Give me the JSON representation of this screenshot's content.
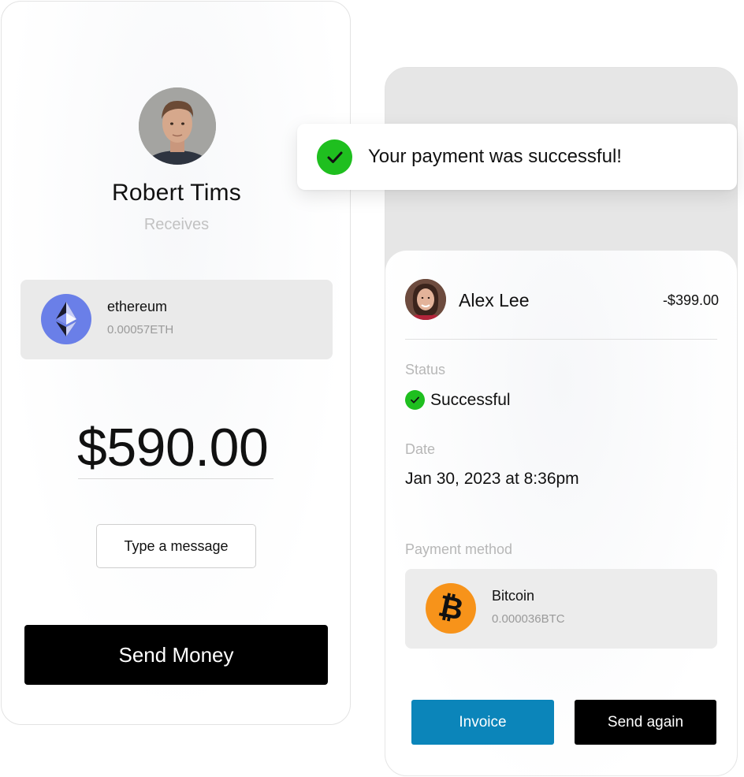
{
  "send_card": {
    "recipient": {
      "name": "Robert Tims",
      "role": "Receives"
    },
    "coin": {
      "name": "ethereum",
      "amount": "0.00057ETH",
      "icon": "ethereum-icon"
    },
    "amount": "$590.00",
    "message_button": "Type a message",
    "send_button": "Send Money"
  },
  "toast": {
    "message": "Your payment was successful!",
    "icon": "check-circle-icon",
    "color": "#1fbf1f"
  },
  "receipt": {
    "payee": {
      "name": "Alex Lee",
      "amount": "-$399.00"
    },
    "status_label": "Status",
    "status_value": "Successful",
    "date_label": "Date",
    "date_value": "Jan 30, 2023 at 8:36pm",
    "payment_method_label": "Payment method",
    "payment_method": {
      "name": "Bitcoin",
      "amount": "0.000036BTC",
      "icon": "bitcoin-icon"
    },
    "invoice_button": "Invoice",
    "send_again_button": "Send again"
  },
  "colors": {
    "accent_blue": "#0b85ba",
    "success_green": "#1fbf1f",
    "ethereum_purple": "#6a7fe8",
    "bitcoin_orange": "#f7931a",
    "primary_black": "#000000"
  }
}
